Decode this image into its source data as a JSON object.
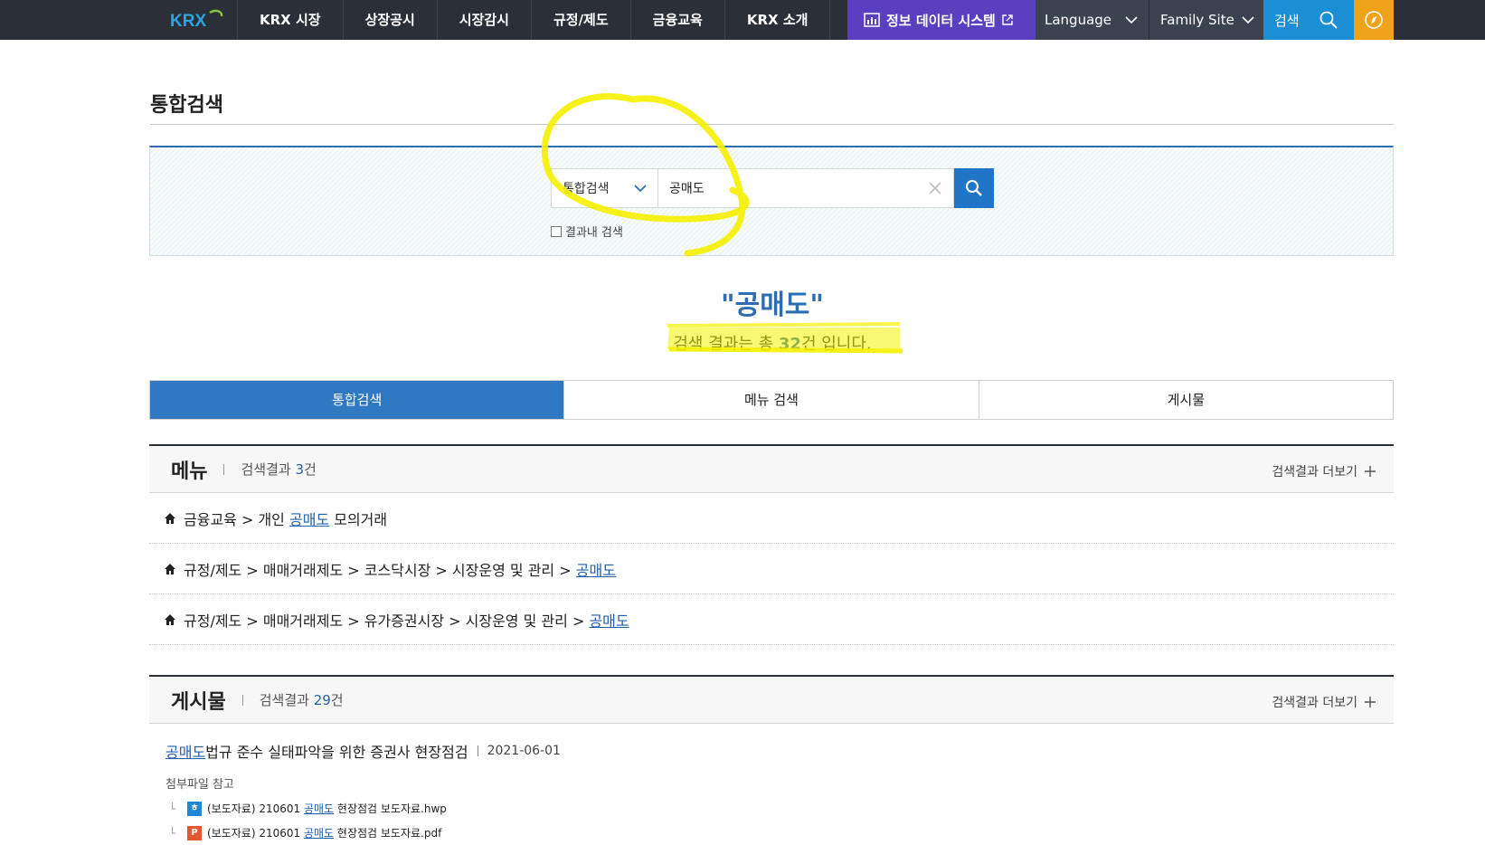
{
  "header": {
    "logo": "KRX",
    "nav": [
      "KRX 시장",
      "상장공시",
      "시장감시",
      "규정/제도",
      "금융교육",
      "KRX 소개"
    ],
    "data_system": "정보 데이터 시스템",
    "language": "Language",
    "family_site": "Family Site",
    "search": "검색"
  },
  "page": {
    "title": "통합검색"
  },
  "search": {
    "scope": "통합검색",
    "query": "공매도",
    "within_label": "결과내 검색"
  },
  "result": {
    "word": "\"공매도\"",
    "count_prefix": "검색 결과는 총 ",
    "count": "32",
    "count_suffix": "건 입니다."
  },
  "tabs": [
    "통합검색",
    "메뉴 검색",
    "게시물"
  ],
  "menu_section": {
    "title": "메뉴",
    "count_prefix": "검색결과 ",
    "count": "3",
    "count_suffix": "건",
    "more": "검색결과 더보기",
    "items": [
      {
        "path": "금융교육 > 개인 ",
        "term": "공매도",
        "tail": " 모의거래"
      },
      {
        "path": "규정/제도 > 매매거래제도 > 코스닥시장 > 시장운영 및 관리 > ",
        "term": "공매도",
        "tail": ""
      },
      {
        "path": "규정/제도 > 매매거래제도 > 유가증권시장 > 시장운영 및 관리 > ",
        "term": "공매도",
        "tail": ""
      }
    ]
  },
  "post_section": {
    "title": "게시물",
    "count_prefix": "검색결과 ",
    "count": "29",
    "count_suffix": "건",
    "more": "검색결과 더보기",
    "post": {
      "term": "공매도",
      "title_rest": " 법규 준수 실태파악을 위한 증권사 현장점검",
      "date": "2021-06-01",
      "note": "첨부파일 참고",
      "attachments": [
        {
          "prefix": "(보도자료) 210601 ",
          "term": "공매도",
          "suffix": " 현장점검 보도자료.hwp",
          "icon": "hwp-icon",
          "color": "#1e88d6"
        },
        {
          "prefix": "(보도자료) 210601 ",
          "term": "공매도",
          "suffix": " 현장점검 보도자료.pdf",
          "icon": "pdf-icon",
          "color": "#e4572e"
        }
      ]
    }
  },
  "colors": {
    "primary": "#2f78c2",
    "topbar": "#2b2f37",
    "data_system": "#5a3fc0",
    "search": "#1a8fd6",
    "compass": "#f0a31a",
    "highlighter": "#f5f000"
  }
}
